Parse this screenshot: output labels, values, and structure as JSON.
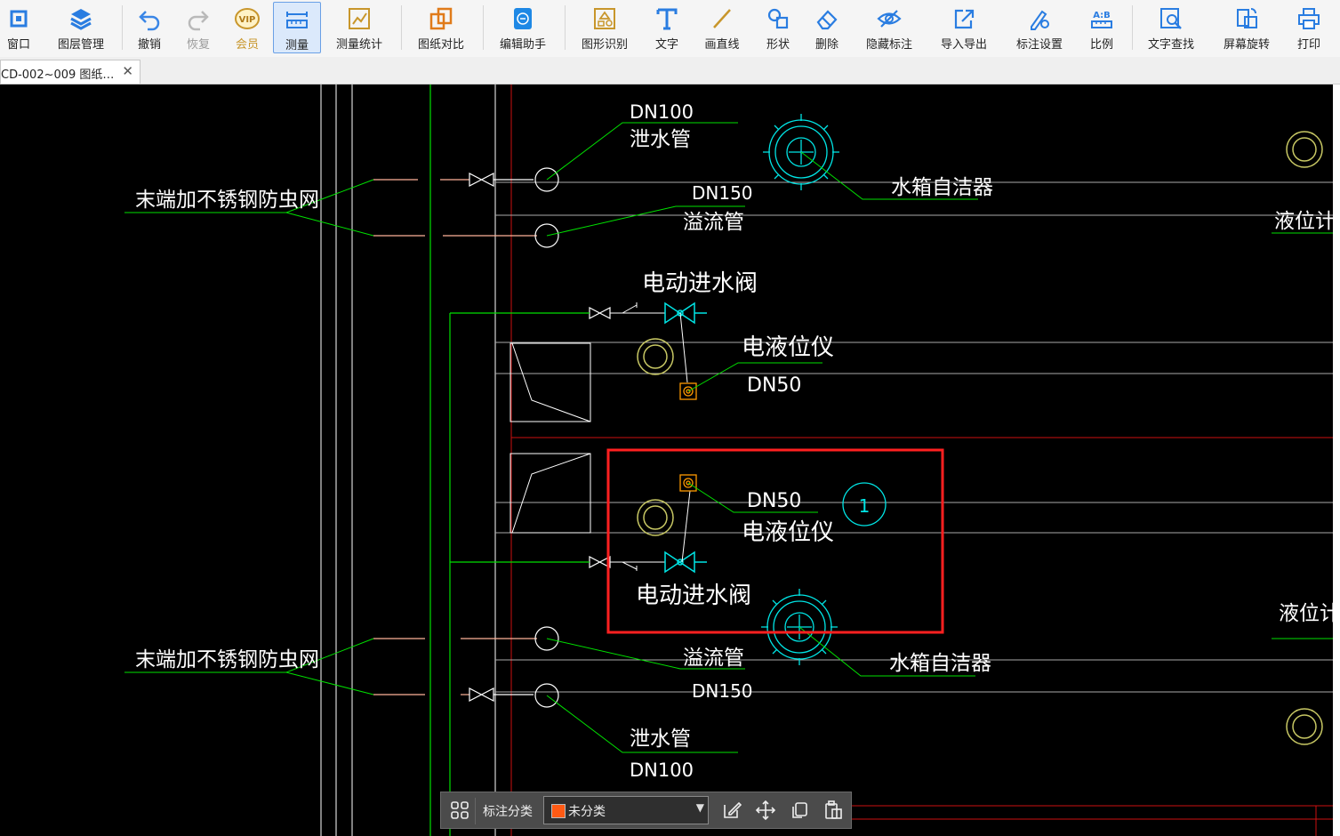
{
  "toolbar": {
    "items": [
      {
        "label": "窗口",
        "icon": "window-icon"
      },
      {
        "label": "图层管理",
        "icon": "layers-icon"
      },
      {
        "label": "撤销",
        "icon": "undo-icon"
      },
      {
        "label": "恢复",
        "icon": "redo-icon"
      },
      {
        "label": "会员",
        "icon": "vip-icon"
      },
      {
        "label": "测量",
        "icon": "ruler-icon"
      },
      {
        "label": "测量统计",
        "icon": "measure-stats-icon"
      },
      {
        "label": "图纸对比",
        "icon": "compare-icon"
      },
      {
        "label": "编辑助手",
        "icon": "cad-edit-icon"
      },
      {
        "label": "图形识别",
        "icon": "shape-recognition-icon"
      },
      {
        "label": "文字",
        "icon": "text-icon"
      },
      {
        "label": "画直线",
        "icon": "line-icon"
      },
      {
        "label": "形状",
        "icon": "shape-icon"
      },
      {
        "label": "删除",
        "icon": "eraser-icon"
      },
      {
        "label": "隐藏标注",
        "icon": "hide-eye-icon"
      },
      {
        "label": "导入导出",
        "icon": "import-export-icon"
      },
      {
        "label": "标注设置",
        "icon": "annotation-settings-icon"
      },
      {
        "label": "比例",
        "icon": "scale-icon",
        "badge": "A:B"
      },
      {
        "label": "文字查找",
        "icon": "text-search-icon"
      },
      {
        "label": "屏幕旋转",
        "icon": "screen-rotate-icon"
      },
      {
        "label": "打印",
        "icon": "printer-icon"
      }
    ],
    "vip_badge": "VIP",
    "active": "测量",
    "disabled": [
      "恢复"
    ]
  },
  "tab": {
    "title": "CD-002~009 图纸…",
    "close": "✕"
  },
  "drawing": {
    "labels": {
      "dn100_top": "DN100",
      "drain_top": "泄水管",
      "cleaner_top": "水箱自洁器",
      "mesh_top": "末端加不锈钢防虫网",
      "dn150_top": "DN150",
      "overflow_top": "溢流管",
      "level_gauge_right_top": "液位计",
      "motor_valve_top": "电动进水阀",
      "level_meter_top": "电液位仪",
      "dn50_top": "DN50",
      "dn50_mid": "DN50",
      "level_meter_mid": "电液位仪",
      "motor_valve_mid": "电动进水阀",
      "marker_number": "1",
      "level_gauge_right_bottom": "液位计",
      "mesh_bottom": "末端加不锈钢防虫网",
      "overflow_bottom": "溢流管",
      "cleaner_bottom": "水箱自洁器",
      "dn150_bottom": "DN150",
      "drain_bottom": "泄水管",
      "dn100_bottom": "DN100"
    },
    "colors": {
      "leader": "#00e000",
      "pipe": "#ffffff",
      "gray": "#aaaaaa",
      "cyan": "#00e5e5",
      "red_line": "#cc1111",
      "highlight_box": "#ff2020",
      "salmon": "#ffb49a",
      "orange": "#ff9900",
      "yellow_circle": "#c8c864",
      "floatbar_swatch": "#ff5a14"
    }
  },
  "floatbar": {
    "label": "标注分类",
    "selected": "未分类",
    "icons": [
      "grid-icon",
      "edit-icon",
      "move-icon",
      "copy-icon",
      "paste-icon"
    ]
  }
}
